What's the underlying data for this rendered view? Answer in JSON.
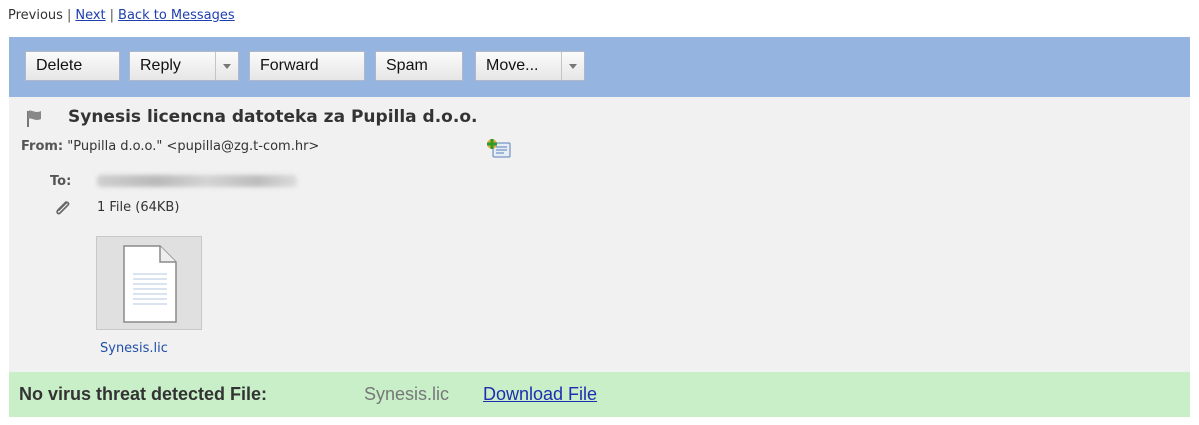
{
  "nav": {
    "previous": "Previous",
    "sep": "|",
    "next": "Next",
    "back": "Back to Messages"
  },
  "toolbar": {
    "delete": "Delete",
    "reply": "Reply",
    "forward": "Forward",
    "spam": "Spam",
    "move": "Move..."
  },
  "colors": {
    "toolbar_bg": "#96b4e0",
    "panel_bg": "#f1f1f1",
    "virus_bar_bg": "#c9efc9",
    "link": "#1f3fae"
  },
  "message": {
    "subject": "Synesis licencna datoteka za Pupilla d.o.o.",
    "from_label": "From:",
    "from_value": "\"Pupilla d.o.o.\" <pupilla@zg.t-com.hr>",
    "to_label": "To:",
    "attachments_summary": "1 File (64KB)",
    "attachment_name": "Synesis.lic"
  },
  "virus": {
    "status": "No virus threat detected File:",
    "file": "Synesis.lic",
    "download": "Download File"
  },
  "icons": [
    "flag-icon",
    "add-contact-icon",
    "paperclip-icon",
    "document-icon",
    "dropdown-caret-icon"
  ]
}
